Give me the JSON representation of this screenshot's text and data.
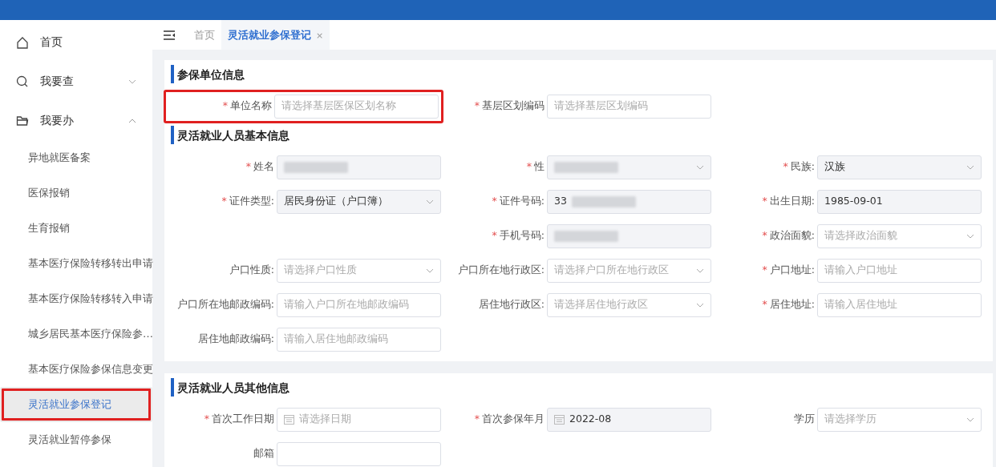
{
  "sidebar": {
    "items": [
      {
        "label": "首页",
        "kind": "top"
      },
      {
        "label": "我要查",
        "kind": "group",
        "expanded": false
      },
      {
        "label": "我要办",
        "kind": "group",
        "expanded": true,
        "children": [
          {
            "label": "异地就医备案",
            "selected": false,
            "highlighted": false
          },
          {
            "label": "医保报销",
            "selected": false,
            "highlighted": false
          },
          {
            "label": "生育报销",
            "selected": false,
            "highlighted": false
          },
          {
            "label": "基本医疗保险转移转出申请",
            "selected": false,
            "highlighted": false
          },
          {
            "label": "基本医疗保险转移转入申请",
            "selected": false,
            "highlighted": false
          },
          {
            "label": "城乡居民基本医疗保险参…",
            "selected": false,
            "highlighted": false
          },
          {
            "label": "基本医疗保险参保信息变更",
            "selected": false,
            "highlighted": false
          },
          {
            "label": "灵活就业参保登记",
            "selected": true,
            "highlighted": true
          },
          {
            "label": "灵活就业暂停参保",
            "selected": false,
            "highlighted": false
          }
        ]
      }
    ]
  },
  "tabs": [
    {
      "label": "首页",
      "selected": false
    },
    {
      "label": "灵活就业参保登记",
      "selected": true,
      "close": "×"
    }
  ],
  "panels": [
    {
      "sections": [
        {
          "title": "参保单位信息",
          "rows": [
            [
              {
                "kind": "input",
                "label": "单位名称",
                "required_mark": "*",
                "placeholder": "请选择基层医保区划名称",
                "highlighted": true
              },
              {
                "kind": "input",
                "label": "基层区划编码",
                "required_mark": "*",
                "placeholder": "请选择基层区划编码"
              },
              {
                "kind": "blank"
              }
            ]
          ]
        },
        {
          "title": "灵活就业人员基本信息",
          "rows": [
            [
              {
                "kind": "input",
                "label": "姓名",
                "required_mark": "*",
                "disabled": true,
                "redacted": true
              },
              {
                "kind": "select",
                "label": "性",
                "required_mark": "*",
                "disabled": true,
                "redacted": true
              },
              {
                "kind": "select",
                "label": "民族:",
                "required_mark": "*",
                "disabled": true,
                "value": "汉族"
              }
            ],
            [
              {
                "kind": "select",
                "label": "证件类型:",
                "required_mark": "*",
                "disabled": true,
                "value": "居民身份证（户口簿）"
              },
              {
                "kind": "input",
                "label": "证件号码:",
                "required_mark": "*",
                "disabled": true,
                "value": "33",
                "redacted": true
              },
              {
                "kind": "input",
                "label": "出生日期:",
                "required_mark": "*",
                "disabled": true,
                "value": "1985-09-01"
              }
            ],
            [
              {
                "kind": "blank"
              },
              {
                "kind": "input",
                "label": "手机号码:",
                "required_mark": "*",
                "disabled": true,
                "redacted": true
              },
              {
                "kind": "select",
                "label": "政治面貌:",
                "required_mark": "*",
                "placeholder": "请选择政治面貌"
              }
            ],
            [
              {
                "kind": "select",
                "label": "户口性质:",
                "placeholder": "请选择户口性质"
              },
              {
                "kind": "select",
                "label": "户口所在地行政区:",
                "placeholder": "请选择户口所在地行政区"
              },
              {
                "kind": "input",
                "label": "户口地址:",
                "required_mark": "*",
                "placeholder": "请输入户口地址"
              }
            ],
            [
              {
                "kind": "input",
                "label": "户口所在地邮政编码:",
                "placeholder": "请输入户口所在地邮政编码"
              },
              {
                "kind": "select",
                "label": "居住地行政区:",
                "placeholder": "请选择居住地行政区"
              },
              {
                "kind": "input",
                "label": "居住地址:",
                "required_mark": "*",
                "placeholder": "请输入居住地址"
              }
            ],
            [
              {
                "kind": "input",
                "label": "居住地邮政编码:",
                "placeholder": "请输入居住地邮政编码"
              },
              {
                "kind": "blank"
              },
              {
                "kind": "blank"
              }
            ]
          ]
        }
      ]
    },
    {
      "sections": [
        {
          "title": "灵活就业人员其他信息",
          "rows": [
            [
              {
                "kind": "date",
                "label": "首次工作日期",
                "required_mark": "*",
                "placeholder": "请选择日期"
              },
              {
                "kind": "date",
                "label": "首次参保年月",
                "required_mark": "*",
                "disabled": true,
                "value": "2022-08"
              },
              {
                "kind": "select",
                "label": "学历",
                "placeholder": "请选择学历"
              }
            ],
            [
              {
                "kind": "input",
                "label": "邮箱"
              },
              {
                "kind": "blank"
              },
              {
                "kind": "blank"
              }
            ]
          ]
        }
      ]
    }
  ]
}
